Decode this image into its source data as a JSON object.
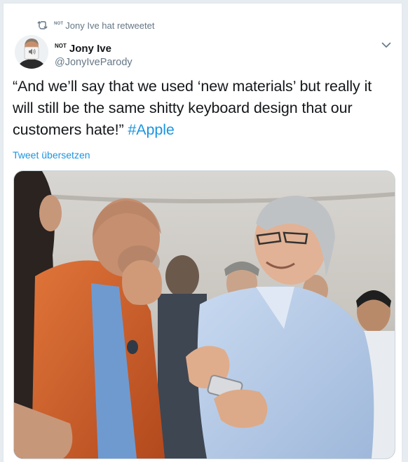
{
  "retweet": {
    "tag": "NOT",
    "text": "Jony Ive hat retweetet"
  },
  "author": {
    "tag": "NOT",
    "display_name": "Jony Ive",
    "handle": "@JonyIveParody"
  },
  "tweet": {
    "text": "“And we’ll say that we used ‘new materials’ but really it will still be the same shitty keyboard design that our customers hate!” ",
    "hashtag": "#Apple",
    "translate_label": "Tweet übersetzen"
  },
  "colors": {
    "accent": "#1b95e0",
    "text": "#14171a",
    "secondary": "#657786",
    "background": "#e6ecf0"
  },
  "icons": {
    "retweet": "retweet-icon",
    "caret": "chevron-down-icon"
  }
}
